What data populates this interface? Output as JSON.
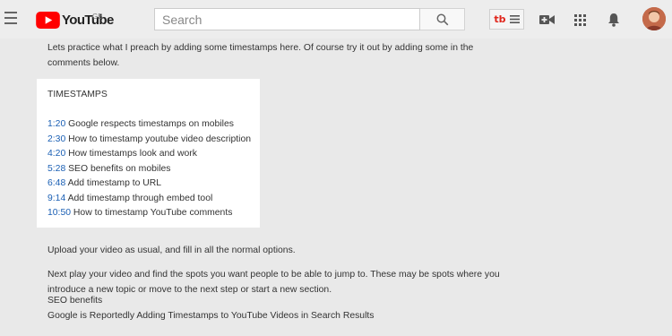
{
  "header": {
    "brand": "YouTube",
    "region": "GB",
    "search_placeholder": "Search"
  },
  "content": {
    "intro": "Lets practice what I preach by adding some timestamps here. Of course try it out by adding some in the comments below.",
    "timestamps_heading": "TIMESTAMPS",
    "timestamps": [
      {
        "time": "1:20",
        "label": "Google respects timestamps on mobiles"
      },
      {
        "time": "2:30",
        "label": "How to timestamp youtube video description"
      },
      {
        "time": "4:20",
        "label": "How timestamps look and work"
      },
      {
        "time": "5:28",
        "label": "SEO benefits on mobiles"
      },
      {
        "time": "6:48",
        "label": "Add timestamp to URL"
      },
      {
        "time": "9:14",
        "label": "Add timestamp through embed tool"
      },
      {
        "time": "10:50",
        "label": "How to timestamp YouTube comments"
      }
    ],
    "upload_line": "Upload your video as usual, and fill in all the normal options.",
    "play_line": "Next play your video and find the spots you want people to be able to jump to. These may be spots where you introduce a new topic or move to the next step or start a new section.",
    "seo_heading": "SEO benefits",
    "seo_line": "Google is Reportedly Adding Timestamps to YouTube Videos in Search Results"
  },
  "colors": {
    "link": "#1a5fb4",
    "brand_red": "#ff0000"
  }
}
